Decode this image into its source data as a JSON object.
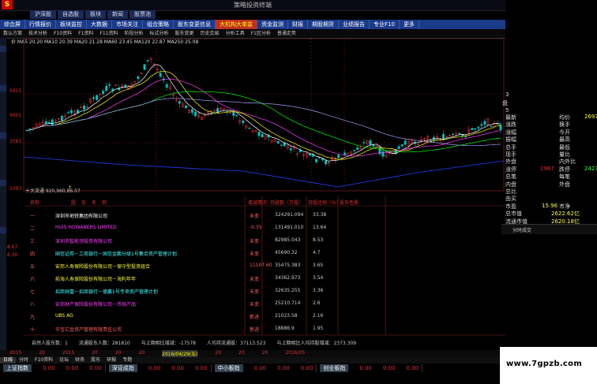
{
  "window": {
    "title": "策略投资终端",
    "logo": "S"
  },
  "nav_tabs": [
    "沪深股",
    "自选股",
    "板块",
    "新闻",
    "股票池"
  ],
  "menu": [
    "综合屏",
    "行情报价",
    "板块监控",
    "大数据",
    "市场关注",
    "组合策略",
    "股东变更信息",
    "大机构大单监",
    "资金监测",
    "财报",
    "期股期货",
    "业绩报告",
    "专业F10",
    "更多"
  ],
  "menu_active_index": 7,
  "toolbar": [
    "数认方案",
    "技术分析",
    "F10资料",
    "F1资料",
    "F11资料",
    "阶段分析",
    "标式分析",
    "股东变更",
    "历史交易",
    "分析工具",
    "F1区分析",
    "普通走势"
  ],
  "ma_legend": "价 MA5 20.20 MA10 20.39 MA20 21.28 MA60 23.45 MA120 22.87 MA250 25.08",
  "price_labels": {
    "top": "5915",
    "mid": "9901",
    "low": "3581",
    "bottom": "1093",
    "side_left": "8.67",
    "side_left2": "6.30"
  },
  "marker": "↑",
  "bottom_line": "十大流通 920,960,86.07",
  "table": {
    "headers": [
      "名称",
      "股东名称",
      "增减情况",
      "持股数（万股）",
      "持股比例（%）",
      "股东性质"
    ],
    "rows": [
      {
        "rank": "一",
        "name": "深圳市地铁集团有限公司",
        "change": "未变",
        "shares": "324291.094",
        "ratio": "33.38"
      },
      {
        "rank": "二",
        "name": "HUIS HOWANERS LIMITED",
        "change": "-0.35",
        "shares": "131491.010",
        "ratio": "13.64"
      },
      {
        "rank": "三",
        "name": "深圳市智能领投资有限公司",
        "change": "未变",
        "shares": "82985.043",
        "ratio": "8.53"
      },
      {
        "rank": "四",
        "name": "国信证券－工商银行－国信金鹏分级1号集合资产管理计划",
        "change": "未变",
        "shares": "45690.32",
        "ratio": "4.7"
      },
      {
        "rank": "五",
        "name": "安邦人寿保险股份有限公司－保守型投资组合",
        "change": "11107.60",
        "shares": "35475.383",
        "ratio": "3.65"
      },
      {
        "rank": "六",
        "name": "前海人寿保险股份有限公司－海利年年",
        "change": "未变",
        "shares": "34362.973",
        "ratio": "3.54"
      },
      {
        "rank": "七",
        "name": "招商财富－招商银行－德赢1号专项资产管理计划",
        "change": "未变",
        "shares": "32635.255",
        "ratio": "3.36"
      },
      {
        "rank": "八",
        "name": "安邦财产保险股份有限公司－传统产品",
        "change": "未变",
        "shares": "25210.714",
        "ratio": "2.6"
      },
      {
        "rank": "九",
        "name": "UBS AG",
        "change": "新进",
        "shares": "21023.58",
        "ratio": "2.16"
      },
      {
        "rank": "十",
        "name": "华宝汇金资产管理有限责任公司",
        "change": "新进",
        "shares": "18886.9",
        "ratio": "1.95"
      }
    ]
  },
  "summary": [
    "自然人股东数：1",
    "流通股东人数：281810",
    "与上期相比增减：-17578",
    "人均持流通股：37113.523",
    "与上期相比人均持股增减：2373.309"
  ],
  "dates": [
    "2015",
    "20",
    "2015",
    "20",
    "20",
    "20",
    "2016/04/29(五)",
    "20",
    "20",
    "20",
    "2016/05"
  ],
  "subtabs": [
    "日线",
    "分时",
    "F10资料",
    "论坛",
    "财务",
    "股东",
    "研报",
    "专题"
  ],
  "index_bar": [
    {
      "name": "上证指数",
      "values": [
        "0.00",
        "0.00",
        "0.00"
      ]
    },
    {
      "name": "深证成指",
      "values": [
        "0.00",
        "0.00",
        "0.00"
      ]
    },
    {
      "name": "中小板指",
      "values": [
        "0.00",
        "0.00",
        "0.00"
      ]
    },
    {
      "name": "创业板指",
      "values": [
        "0.00",
        "0.00",
        "0.00"
      ]
    }
  ],
  "right_panel": {
    "corner_labels": [
      "3",
      "5"
    ],
    "small_label": "盘",
    "rows": [
      {
        "l": "最新",
        "r": "均价",
        "rv": "2697"
      },
      {
        "l": "涨跌",
        "r": "换手"
      },
      {
        "l": "涨幅",
        "r": "今开"
      },
      {
        "l": "振幅",
        "r": "最高"
      },
      {
        "l": "总手",
        "r": "最低"
      },
      {
        "l": "现手",
        "r": "量比"
      },
      {
        "l": "外盘",
        "r": "内外比"
      },
      {
        "l": "涨停",
        "lv": "2967",
        "r": "跌停",
        "rv": "2427"
      },
      {
        "l": "总笔",
        "r": "每笔"
      },
      {
        "l": "内盘",
        "r": "外盘"
      },
      {
        "l": "总比",
        "r": ""
      },
      {
        "l": "由买",
        "r": ""
      },
      {
        "l": "市盈",
        "lv": "15.96",
        "r": "市净"
      },
      {
        "l": "总市值",
        "lv": "2622.62亿"
      },
      {
        "l": "流通市值",
        "lv": "2620.18亿"
      }
    ],
    "box_label": "分时成交"
  },
  "watermark": "www.7gpzb.com",
  "colors": {
    "up": "#e03030",
    "down": "#00c0c0",
    "ma5": "#ffffff",
    "ma10": "#ffff00",
    "ma20": "#ff40ff",
    "ma60": "#00ff00",
    "ma120": "#a0a0ff"
  }
}
